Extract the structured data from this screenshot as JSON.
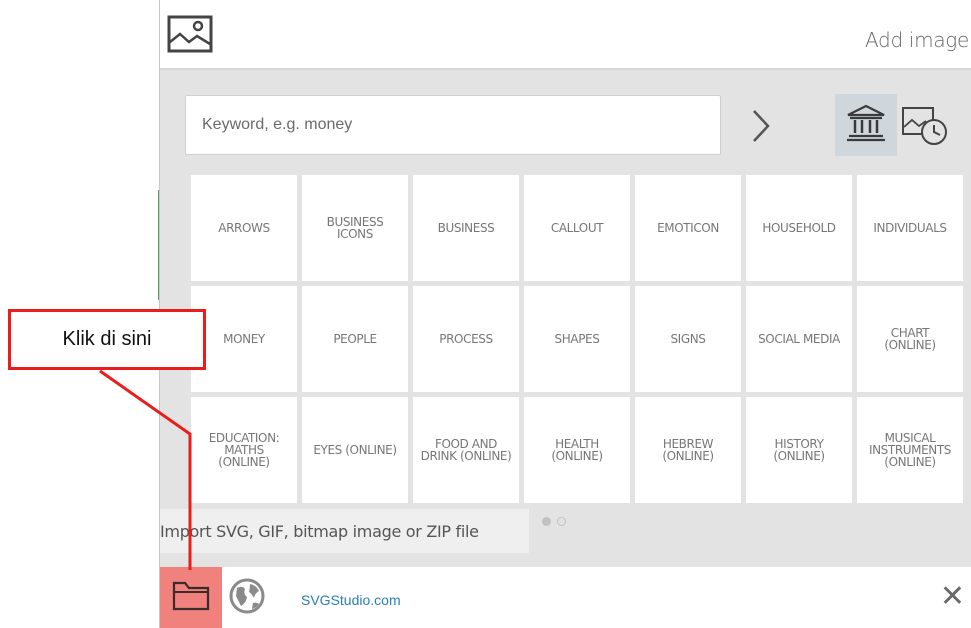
{
  "header": {
    "title": "Add image",
    "icon": "image-icon"
  },
  "search": {
    "placeholder": "Keyword, e.g. money",
    "value": ""
  },
  "toolbar": {
    "go_icon": "chevron-right-icon",
    "library_icon": "library-icon",
    "history_icon": "history-icon"
  },
  "categories": [
    "ARROWS",
    "BUSINESS\nICONS",
    "BUSINESS",
    "CALLOUT",
    "EMOTICON",
    "HOUSEHOLD",
    "INDIVIDUALS",
    "MONEY",
    "PEOPLE",
    "PROCESS",
    "SHAPES",
    "SIGNS",
    "SOCIAL MEDIA",
    "CHART\n(ONLINE)",
    "EDUCATION:\nMATHS\n(ONLINE)",
    "EYES (ONLINE)",
    "FOOD AND\nDRINK (ONLINE)",
    "HEALTH\n(ONLINE)",
    "HEBREW\n(ONLINE)",
    "HISTORY\n(ONLINE)",
    "MUSICAL\nINSTRUMENTS\n(ONLINE)"
  ],
  "tooltip": {
    "text": "Import SVG, GIF, bitmap image or ZIP file"
  },
  "pagination": {
    "pages": 2,
    "current": 1
  },
  "footer": {
    "import_icon": "folder-icon",
    "globe_icon": "globe-icon",
    "link_text": "SVGStudio.com",
    "close_symbol": "✕"
  },
  "annotation": {
    "label": "Klik di sini"
  },
  "colors": {
    "accent_red": "#ea1c1c",
    "import_button": "#f0817c",
    "link": "#2a7fb8",
    "content_bg": "#e3e3e3",
    "selected_tab": "#cfd7dd"
  }
}
